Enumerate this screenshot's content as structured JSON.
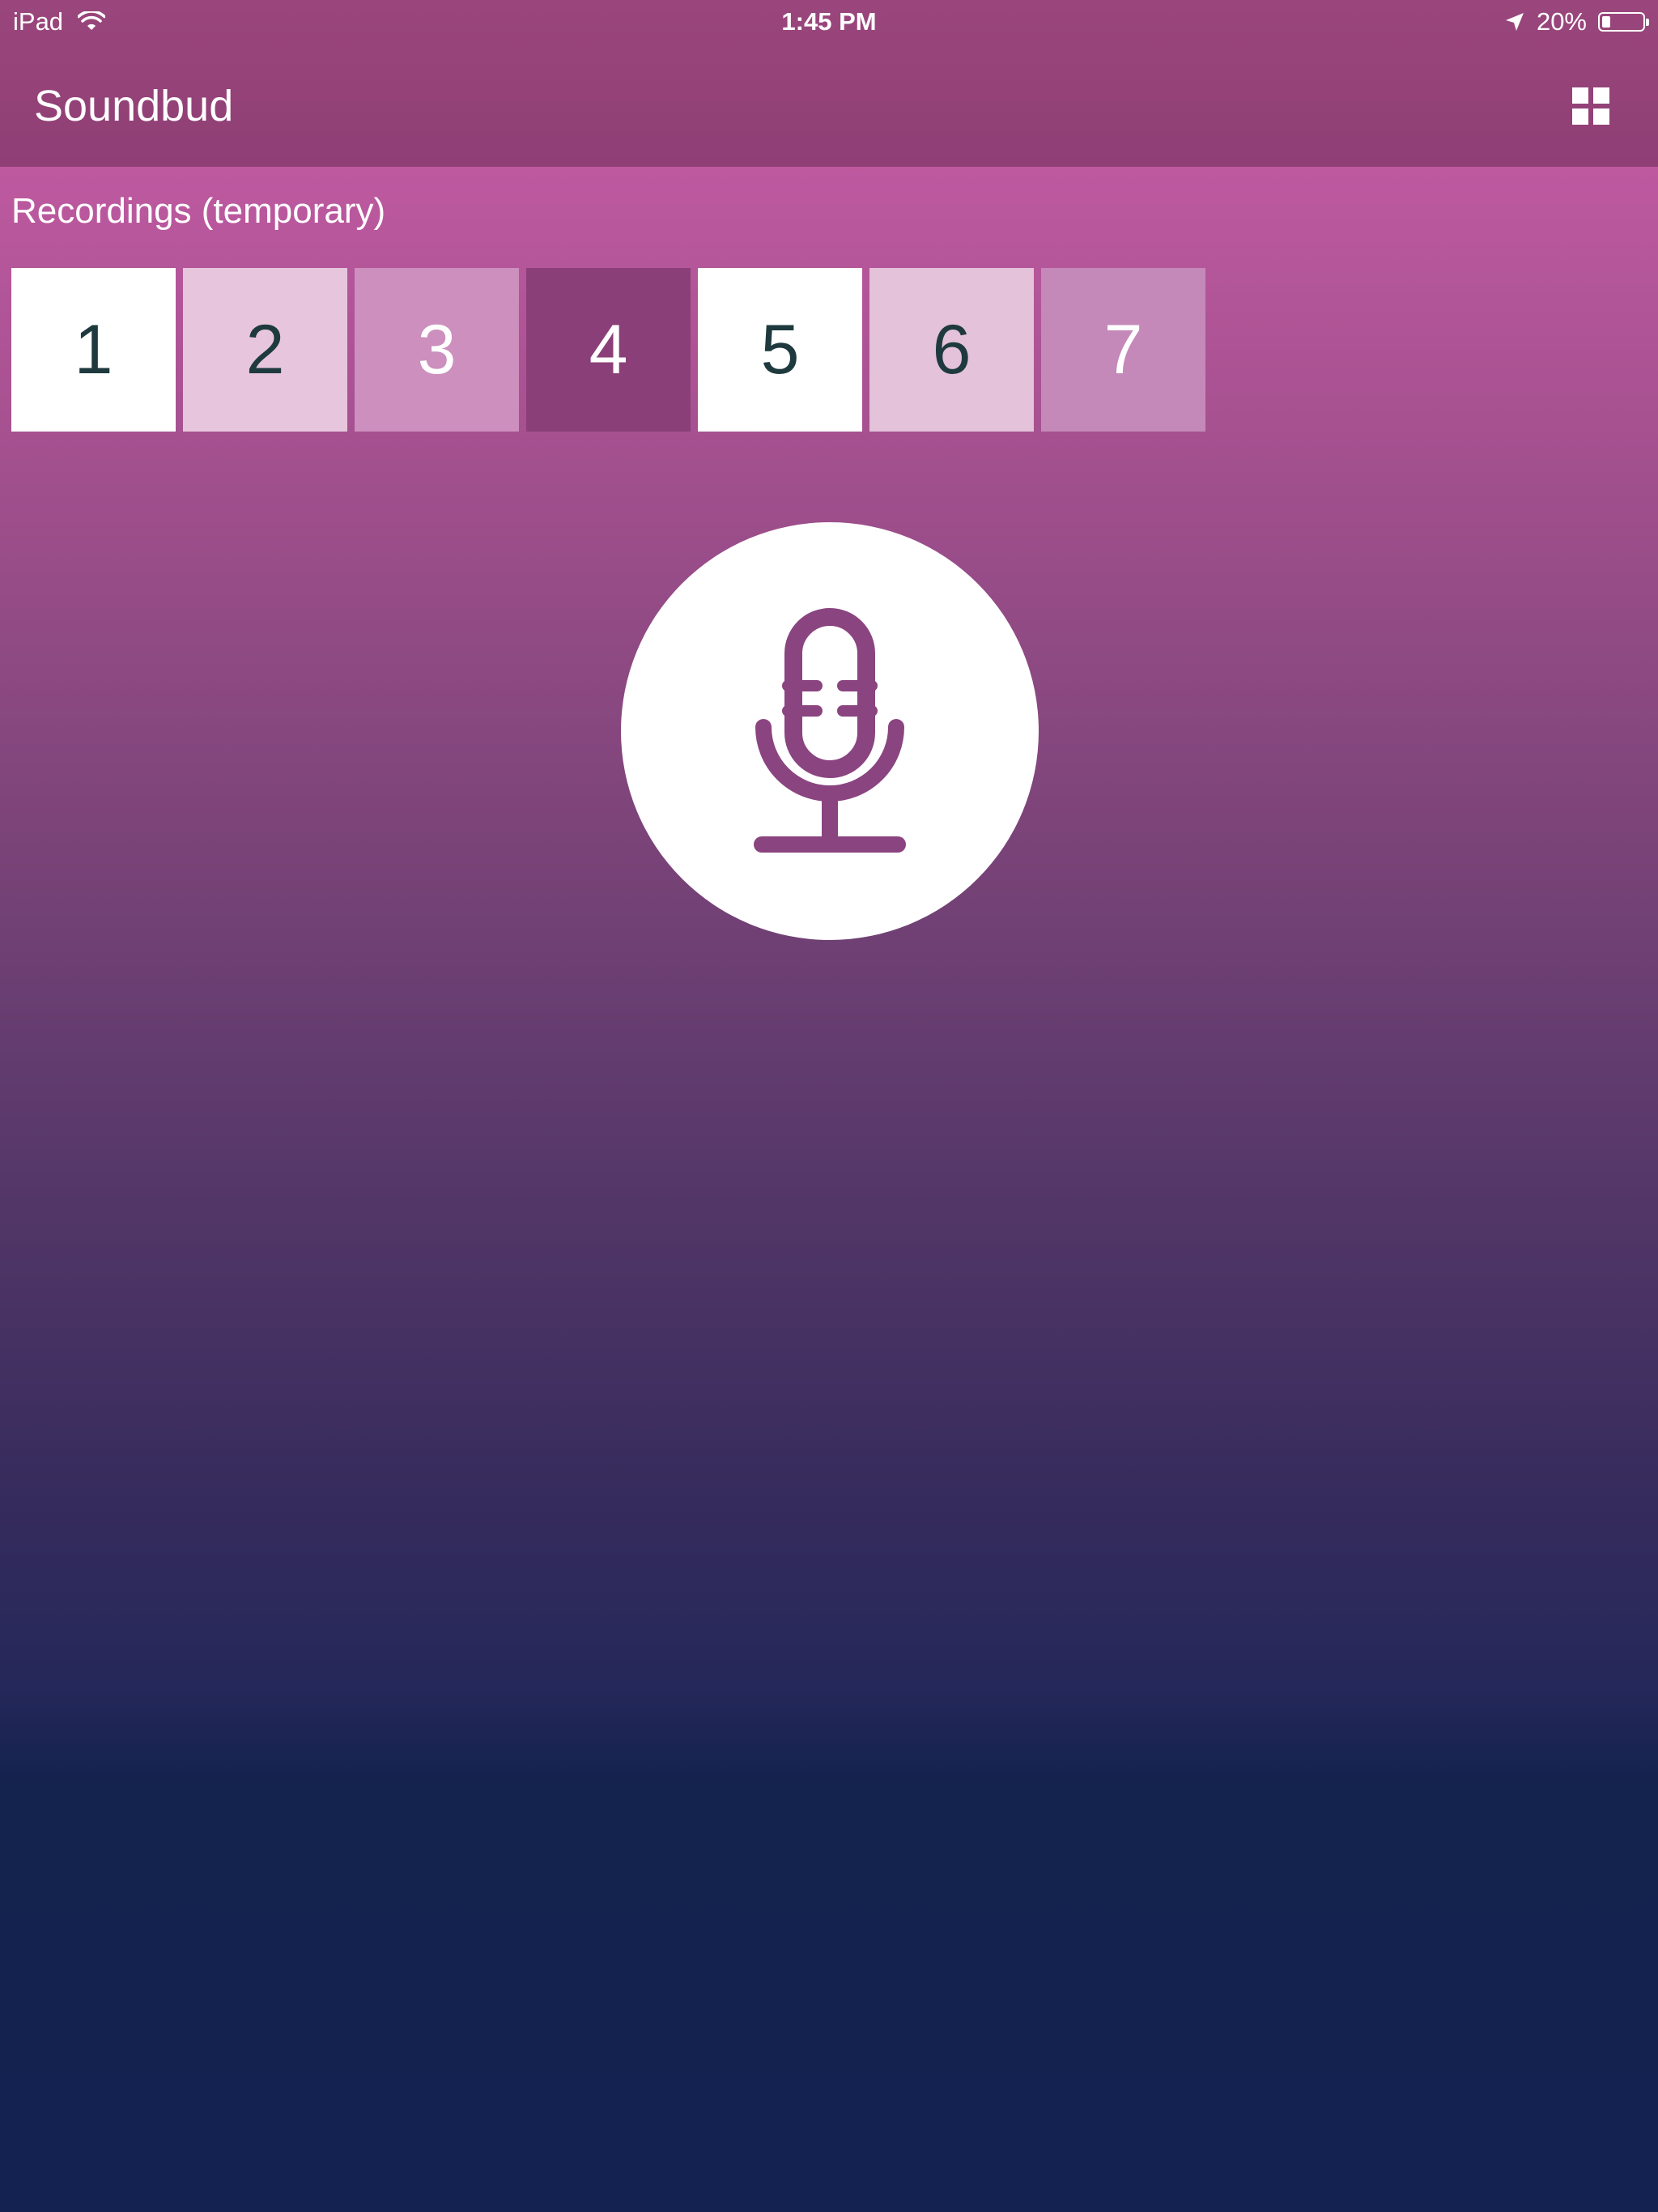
{
  "status_bar": {
    "device": "iPad",
    "time": "1:45 PM",
    "battery": "20%",
    "battery_level": 0.2
  },
  "nav": {
    "title": "Soundbud",
    "grid_icon": "grid-icon"
  },
  "recordings": {
    "title": "Recordings (temporary)",
    "items": [
      {
        "label": "1",
        "bg": "#ffffff",
        "fg": "#1e3a3e"
      },
      {
        "label": "2",
        "bg": "#e7c6dd",
        "fg": "#1e3a3e"
      },
      {
        "label": "3",
        "bg": "#cc8fbe",
        "fg": "#ffffff"
      },
      {
        "label": "4",
        "bg": "#8b3f78",
        "fg": "#ffffff"
      },
      {
        "label": "5",
        "bg": "#ffffff",
        "fg": "#1e3a3e"
      },
      {
        "label": "6",
        "bg": "#e3c2da",
        "fg": "#1e3a3e"
      },
      {
        "label": "7",
        "bg": "#c489b8",
        "fg": "#ffffff"
      }
    ]
  },
  "mic": {
    "icon": "microphone-icon",
    "icon_color": "#8a4480"
  },
  "colors": {
    "accent": "#be59a0",
    "background_bottom": "#132250"
  }
}
